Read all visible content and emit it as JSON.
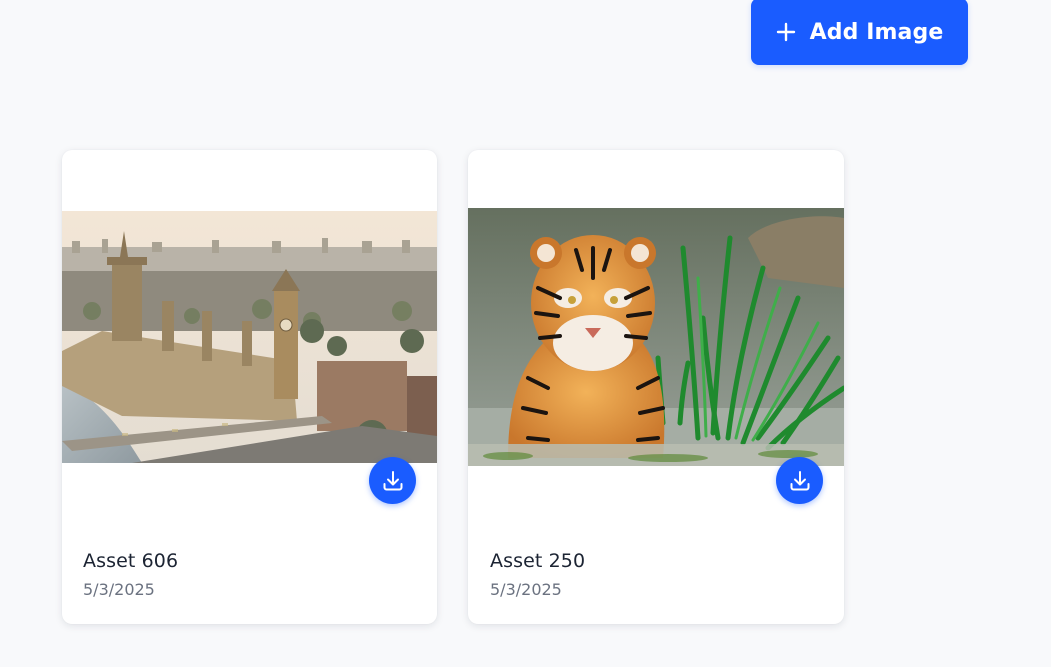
{
  "toolbar": {
    "add_label": "Add Image",
    "add_icon": "plus-icon",
    "accent_color": "#1a5cff"
  },
  "assets": [
    {
      "title": "Asset 606",
      "date": "5/3/2025",
      "image_subject": "aerial view of London with Big Ben and the Houses of Parliament",
      "download_icon": "download-icon"
    },
    {
      "title": "Asset 250",
      "date": "5/3/2025",
      "image_subject": "tiger standing in water beside green reeds",
      "download_icon": "download-icon"
    }
  ]
}
